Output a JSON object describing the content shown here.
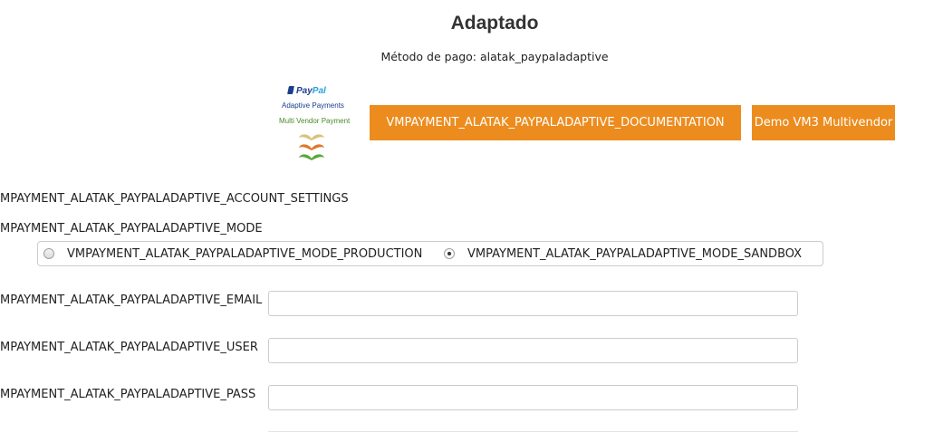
{
  "header": {
    "title": "Adaptado",
    "subtitle": "Método de pago: alatak_paypaladaptive"
  },
  "logo": {
    "paypal_a": "Pay",
    "paypal_b": "Pal",
    "line1": "Adaptive Payments",
    "line2": "Multi Vendor Payment",
    "colors": {
      "paypal_blue": "#1b3e8c",
      "paypal_light": "#2a9fd8",
      "green": "#4a8a2a",
      "mustache_1": "#d9c27a",
      "mustache_2": "#e0772a",
      "mustache_3": "#5aa83a"
    }
  },
  "buttons": {
    "documentation_label": "VMPAYMENT_ALATAK_PAYPALADAPTIVE_DOCUMENTATION",
    "demo_label": "Demo VM3 Multivendor",
    "color": "#ec8c1e"
  },
  "settings": {
    "account_settings_label": "MPAYMENT_ALATAK_PAYPALADAPTIVE_ACCOUNT_SETTINGS",
    "mode_label": "MPAYMENT_ALATAK_PAYPALADAPTIVE_MODE",
    "mode_options": [
      {
        "label": "VMPAYMENT_ALATAK_PAYPALADAPTIVE_MODE_PRODUCTION",
        "checked": false
      },
      {
        "label": "VMPAYMENT_ALATAK_PAYPALADAPTIVE_MODE_SANDBOX",
        "checked": true
      }
    ],
    "email_label": "MPAYMENT_ALATAK_PAYPALADAPTIVE_EMAIL",
    "email_value": "",
    "user_label": "MPAYMENT_ALATAK_PAYPALADAPTIVE_USER",
    "user_value": "",
    "pass_label": "MPAYMENT_ALATAK_PAYPALADAPTIVE_PASS",
    "pass_value": ""
  }
}
